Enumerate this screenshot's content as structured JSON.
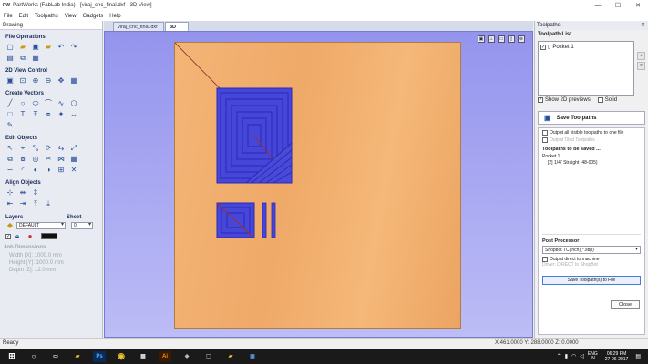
{
  "window": {
    "app_icon": "PW",
    "title": "PartWorks (FabLab India) - [viraj_cnc_final.dxf - 3D View]"
  },
  "menu": [
    "File",
    "Edit",
    "Toolpaths",
    "View",
    "Gadgets",
    "Help"
  ],
  "left_panel": {
    "header": "Drawing",
    "sections": {
      "file_ops": "File Operations",
      "view_ctrl": "2D View Control",
      "create_vec": "Create Vectors",
      "edit_obj": "Edit Objects",
      "align_obj": "Align Objects"
    },
    "layers_label": "Layers",
    "sheet_label": "Sheet",
    "layer_value": "DEFAULT",
    "sheet_value": "0",
    "job": {
      "title": "Job Dimensions",
      "width": "Width  [X]: 1000.0 mm",
      "height": "Height [Y]: 1000.0 mm",
      "depth": "Depth  [Z]: 12.0 mm"
    }
  },
  "tabs": [
    "viraj_cnc_final.dxf",
    "3D View"
  ],
  "right_panel": {
    "title": "Toolpaths",
    "list_title": "Toolpath List",
    "toolpath_item": "Pocket 1",
    "show_previews": "Show 2D previews",
    "solid": "Solid",
    "save_toolpaths": "Save Toolpaths",
    "opt_one_file": "Output all visible toolpaths to one file",
    "opt_tiled": "Output Tiled Toolpaths",
    "to_be_saved": "Toolpaths to be saved ...",
    "saved_item": "Pocket 1",
    "saved_tool": "[2] 1/4\" Straight  (48-005)",
    "post_processor": "Post Processor",
    "pp_value": "Shopbot TC(inch)(*.sbp)",
    "direct_output": "Output direct to machine",
    "driver": "Driver: DIRECT to ShopBot",
    "save_file": "Save Toolpath(s) to File",
    "close": "Close"
  },
  "status": {
    "left": "Ready",
    "coords": "X:461.0000 Y:-288.0000 Z: 0.0000"
  },
  "taskbar": {
    "lang1": "ENG",
    "lang2": "IN",
    "time": "06:29 PM",
    "date": "27-06-2017"
  },
  "colors": {
    "viewport_bg": "#a6a6f2",
    "board": "#f0ae6c",
    "toolpath": "#3a3ad0"
  },
  "icons": [
    "new-file-icon",
    "open-file-icon",
    "save-icon",
    "undo-icon",
    "redo-icon",
    "zoom-icon",
    "line-icon",
    "circle-icon",
    "rectangle-icon",
    "text-icon",
    "select-icon",
    "align-icon",
    "lock-icon",
    "close-icon"
  ]
}
